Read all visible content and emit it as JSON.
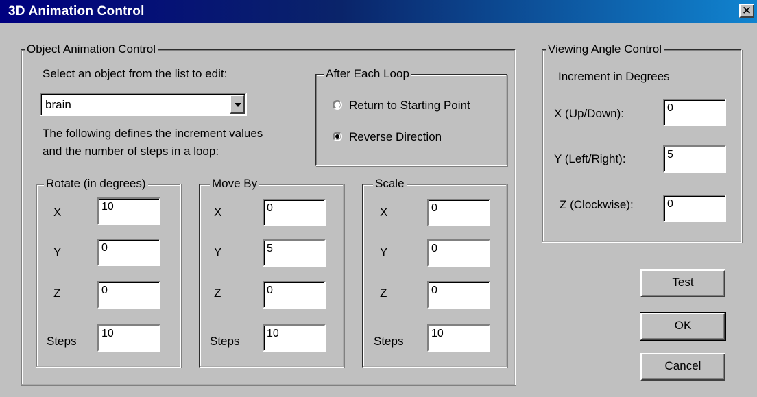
{
  "window": {
    "title": "3D Animation Control",
    "close_label": "✕"
  },
  "object_group": {
    "legend": "Object Animation Control",
    "select_label": "Select an object from the list to edit:",
    "selected_object": "brain",
    "desc_line1": "The following defines the increment values",
    "desc_line2": "and the number of steps in a loop:"
  },
  "after_loop": {
    "legend": "After Each Loop",
    "options": [
      {
        "label": "Return to Starting Point",
        "checked": false
      },
      {
        "label": "Reverse Direction",
        "checked": true
      }
    ]
  },
  "rotate": {
    "legend": "Rotate (in degrees)",
    "labels": {
      "x": "X",
      "y": "Y",
      "z": "Z",
      "steps": "Steps"
    },
    "values": {
      "x": "10",
      "y": "0",
      "z": "0",
      "steps": "10"
    }
  },
  "move": {
    "legend": "Move By",
    "labels": {
      "x": "X",
      "y": "Y",
      "z": "Z",
      "steps": "Steps"
    },
    "values": {
      "x": "0",
      "y": "5",
      "z": "0",
      "steps": "10"
    }
  },
  "scale": {
    "legend": "Scale",
    "labels": {
      "x": "X",
      "y": "Y",
      "z": "Z",
      "steps": "Steps"
    },
    "values": {
      "x": "0",
      "y": "0",
      "z": "0",
      "steps": "10"
    }
  },
  "viewing": {
    "legend": "Viewing Angle Control",
    "subtitle": "Increment in Degrees",
    "labels": {
      "x": "X (Up/Down):",
      "y": "Y (Left/Right):",
      "z": "Z (Clockwise):"
    },
    "values": {
      "x": "0",
      "y": "5",
      "z": "0"
    }
  },
  "buttons": {
    "test": "Test",
    "ok": "OK",
    "cancel": "Cancel"
  }
}
